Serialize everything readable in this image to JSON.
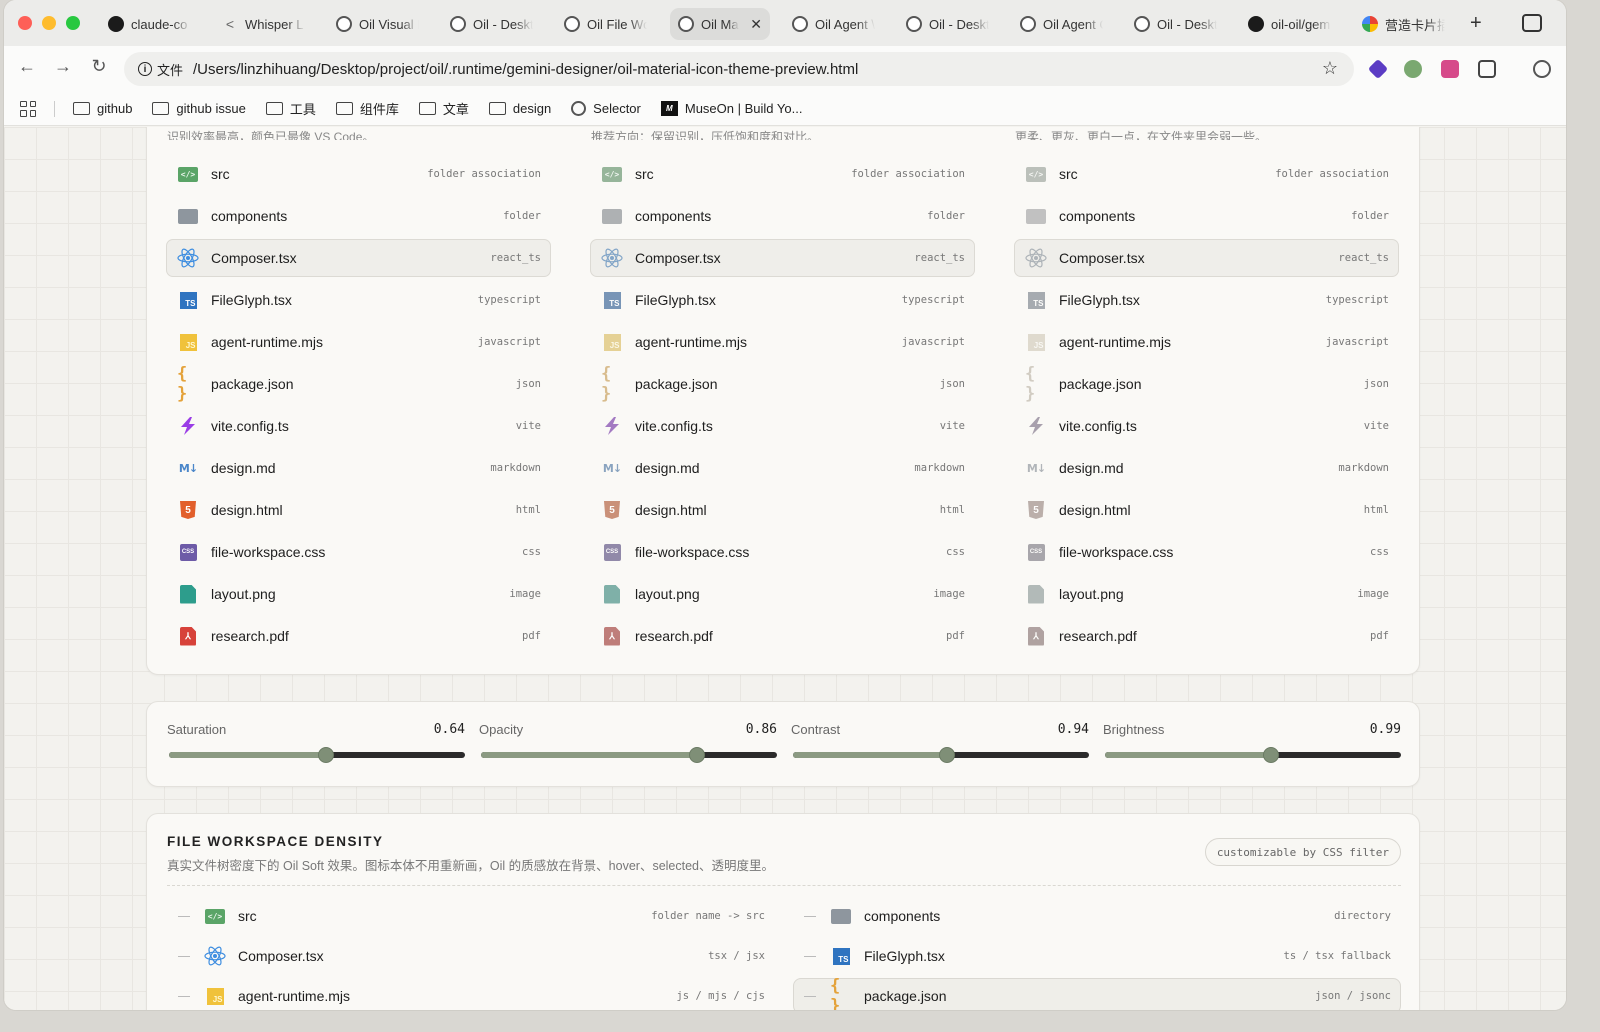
{
  "browser": {
    "tabs": [
      {
        "label": "claude-co",
        "icon": "github-icon"
      },
      {
        "label": "Whisper L",
        "icon": "whisper-icon"
      },
      {
        "label": "Oil Visual F",
        "icon": "globe-icon"
      },
      {
        "label": "Oil - Deskt",
        "icon": "globe-icon"
      },
      {
        "label": "Oil File Wo",
        "icon": "globe-icon"
      },
      {
        "label": "Oil Ma",
        "icon": "globe-icon",
        "active": true
      },
      {
        "label": "Oil Agent \\",
        "icon": "globe-icon"
      },
      {
        "label": "Oil - Deskt",
        "icon": "globe-icon"
      },
      {
        "label": "Oil Agent C",
        "icon": "globe-icon"
      },
      {
        "label": "Oil - Deskt",
        "icon": "globe-icon"
      },
      {
        "label": "oil-oil/gem",
        "icon": "github-icon"
      },
      {
        "label": "营造卡片插",
        "icon": "app-icon"
      }
    ],
    "new_tab": "+",
    "url_scheme_label": "文件",
    "url": "/Users/linzhihuang/Desktop/project/oil/.runtime/gemini-designer/oil-material-icon-theme-preview.html",
    "bookmarks": [
      {
        "label": "github",
        "icon": "folder-icon"
      },
      {
        "label": "github issue",
        "icon": "folder-icon"
      },
      {
        "label": "工具",
        "icon": "folder-icon"
      },
      {
        "label": "组件库",
        "icon": "folder-icon"
      },
      {
        "label": "文章",
        "icon": "folder-icon"
      },
      {
        "label": "design",
        "icon": "folder-icon"
      },
      {
        "label": "Selector",
        "icon": "globe-icon"
      },
      {
        "label": "MuseOn | Build Yo...",
        "icon": "museon-icon"
      }
    ]
  },
  "preview": {
    "columns": [
      {
        "desc": "识别效率最高，颜色已最像 VS Code。"
      },
      {
        "desc": "推荐方向：保留识别，压低饱和度和对比。"
      },
      {
        "desc": "更柔、更灰、更白一点，在文件夹里会弱一些。"
      }
    ],
    "files": [
      {
        "name": "src",
        "meta": "folder association",
        "icon": "src-folder-icon"
      },
      {
        "name": "components",
        "meta": "folder",
        "icon": "folder-icon"
      },
      {
        "name": "Composer.tsx",
        "meta": "react_ts",
        "icon": "react-icon",
        "selected": true
      },
      {
        "name": "FileGlyph.tsx",
        "meta": "typescript",
        "icon": "typescript-icon"
      },
      {
        "name": "agent-runtime.mjs",
        "meta": "javascript",
        "icon": "javascript-icon"
      },
      {
        "name": "package.json",
        "meta": "json",
        "icon": "json-icon"
      },
      {
        "name": "vite.config.ts",
        "meta": "vite",
        "icon": "vite-icon"
      },
      {
        "name": "design.md",
        "meta": "markdown",
        "icon": "markdown-icon"
      },
      {
        "name": "design.html",
        "meta": "html",
        "icon": "html-icon"
      },
      {
        "name": "file-workspace.css",
        "meta": "css",
        "icon": "css-icon"
      },
      {
        "name": "layout.png",
        "meta": "image",
        "icon": "image-icon"
      },
      {
        "name": "research.pdf",
        "meta": "pdf",
        "icon": "pdf-icon"
      }
    ]
  },
  "sliders": [
    {
      "label": "Saturation",
      "value": "0.64",
      "fraction": 0.53
    },
    {
      "label": "Opacity",
      "value": "0.86",
      "fraction": 0.73
    },
    {
      "label": "Contrast",
      "value": "0.94",
      "fraction": 0.52
    },
    {
      "label": "Brightness",
      "value": "0.99",
      "fraction": 0.56
    }
  ],
  "density": {
    "title": "FILE WORKSPACE DENSITY",
    "subtitle": "真实文件树密度下的 Oil Soft 效果。图标本体不用重新画，Oil 的质感放在背景、hover、selected、透明度里。",
    "badge": "customizable by CSS filter",
    "left_rows": [
      {
        "name": "src",
        "meta": "folder name -> src",
        "icon": "src-folder-icon"
      },
      {
        "name": "Composer.tsx",
        "meta": "tsx / jsx",
        "icon": "react-icon"
      },
      {
        "name": "agent-runtime.mjs",
        "meta": "js / mjs / cjs",
        "icon": "javascript-icon"
      }
    ],
    "right_rows": [
      {
        "name": "components",
        "meta": "directory",
        "icon": "folder-icon"
      },
      {
        "name": "FileGlyph.tsx",
        "meta": "ts / tsx fallback",
        "icon": "typescript-icon"
      },
      {
        "name": "package.json",
        "meta": "json / jsonc",
        "icon": "json-icon",
        "selected": true
      }
    ]
  },
  "colors": {
    "accent": "#8b9a82",
    "track": "#2b2b2b",
    "react": "#3d8de0",
    "vite": "#9a3de6"
  }
}
